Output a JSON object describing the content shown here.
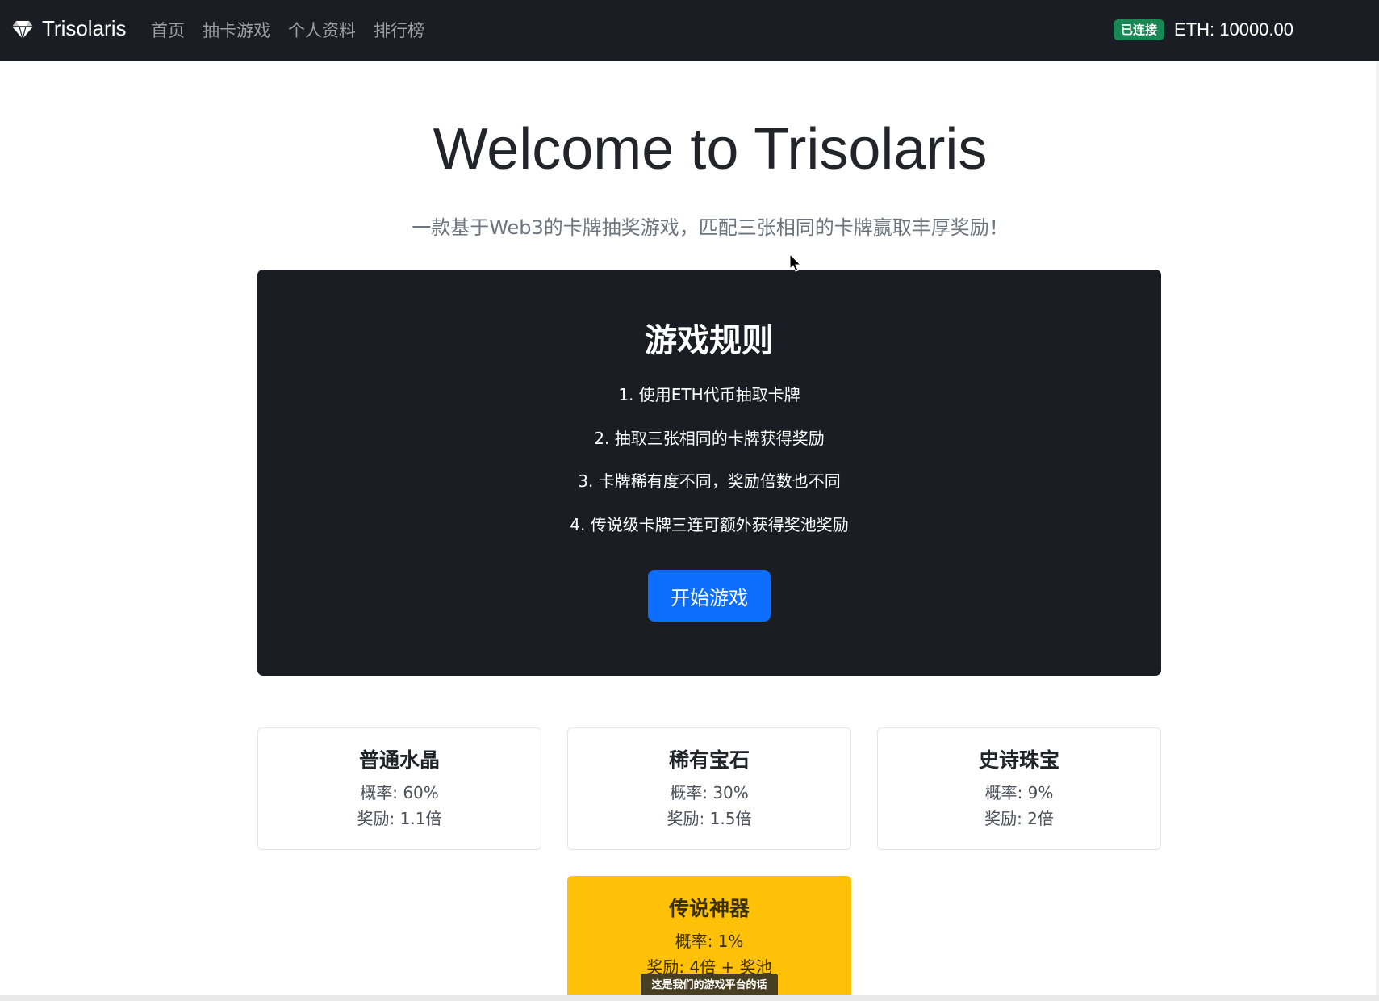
{
  "navbar": {
    "brand": "Trisolaris",
    "brand_icon": "gem-icon",
    "links": [
      "首页",
      "抽卡游戏",
      "个人资料",
      "排行榜"
    ],
    "status_badge": "已连接",
    "eth_balance": "ETH: 10000.00"
  },
  "hero": {
    "title": "Welcome to Trisolaris",
    "subtitle": "一款基于Web3的卡牌抽奖游戏，匹配三张相同的卡牌赢取丰厚奖励！"
  },
  "rules": {
    "title": "游戏规则",
    "items": [
      "1. 使用ETH代币抽取卡牌",
      "2. 抽取三张相同的卡牌获得奖励",
      "3. 卡牌稀有度不同，奖励倍数也不同",
      "4. 传说级卡牌三连可额外获得奖池奖励"
    ],
    "start_button": "开始游戏"
  },
  "cards": [
    {
      "title": "普通水晶",
      "probability": "概率: 60%",
      "reward": "奖励: 1.1倍"
    },
    {
      "title": "稀有宝石",
      "probability": "概率: 30%",
      "reward": "奖励: 1.5倍"
    },
    {
      "title": "史诗珠宝",
      "probability": "概率: 9%",
      "reward": "奖励: 2倍"
    },
    {
      "title": "传说神器",
      "probability": "概率: 1%",
      "reward": "奖励: 4倍 + 奖池"
    }
  ],
  "overlay_caption": "这是我们的游戏平台的话",
  "colors": {
    "navbar_bg": "#1a1d23",
    "badge_green": "#198754",
    "primary_blue": "#0d6efd",
    "legendary_yellow": "#ffc107"
  }
}
